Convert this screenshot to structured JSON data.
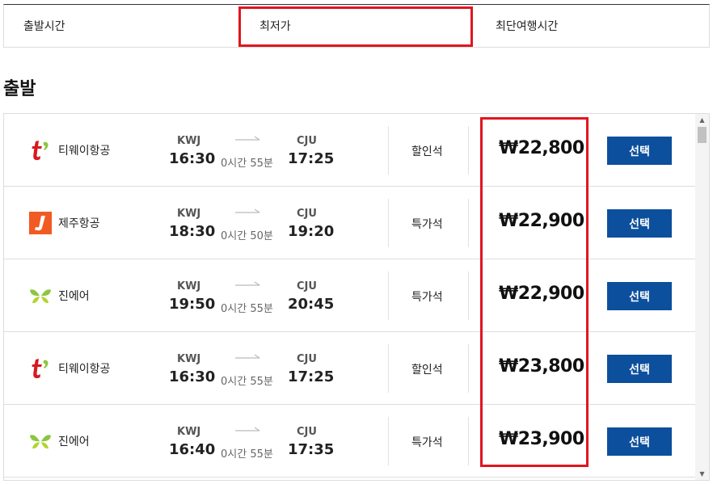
{
  "sort_tabs": [
    {
      "label": "출발시간"
    },
    {
      "label": "최저가"
    },
    {
      "label": "최단여행시간"
    }
  ],
  "section_title": "출발",
  "flights": [
    {
      "airline": "티웨이항공",
      "logo": "tway-logo",
      "dep_code": "KWJ",
      "dep_time": "16:30",
      "duration": "0시간 55분",
      "arr_code": "CJU",
      "arr_time": "17:25",
      "fare_class": "할인석",
      "price": "₩22,800",
      "select_label": "선택"
    },
    {
      "airline": "제주항공",
      "logo": "jejuair-logo",
      "dep_code": "KWJ",
      "dep_time": "18:30",
      "duration": "0시간 50분",
      "arr_code": "CJU",
      "arr_time": "19:20",
      "fare_class": "특가석",
      "price": "₩22,900",
      "select_label": "선택"
    },
    {
      "airline": "진에어",
      "logo": "jinair-logo",
      "dep_code": "KWJ",
      "dep_time": "19:50",
      "duration": "0시간 55분",
      "arr_code": "CJU",
      "arr_time": "20:45",
      "fare_class": "특가석",
      "price": "₩22,900",
      "select_label": "선택"
    },
    {
      "airline": "티웨이항공",
      "logo": "tway-logo",
      "dep_code": "KWJ",
      "dep_time": "16:30",
      "duration": "0시간 55분",
      "arr_code": "CJU",
      "arr_time": "17:25",
      "fare_class": "할인석",
      "price": "₩23,800",
      "select_label": "선택"
    },
    {
      "airline": "진에어",
      "logo": "jinair-logo",
      "dep_code": "KWJ",
      "dep_time": "16:40",
      "duration": "0시간 55분",
      "arr_code": "CJU",
      "arr_time": "17:35",
      "fare_class": "특가석",
      "price": "₩23,900",
      "select_label": "선택"
    }
  ],
  "colors": {
    "select_button": "#0c4f9c",
    "highlight": "#e0161e"
  }
}
